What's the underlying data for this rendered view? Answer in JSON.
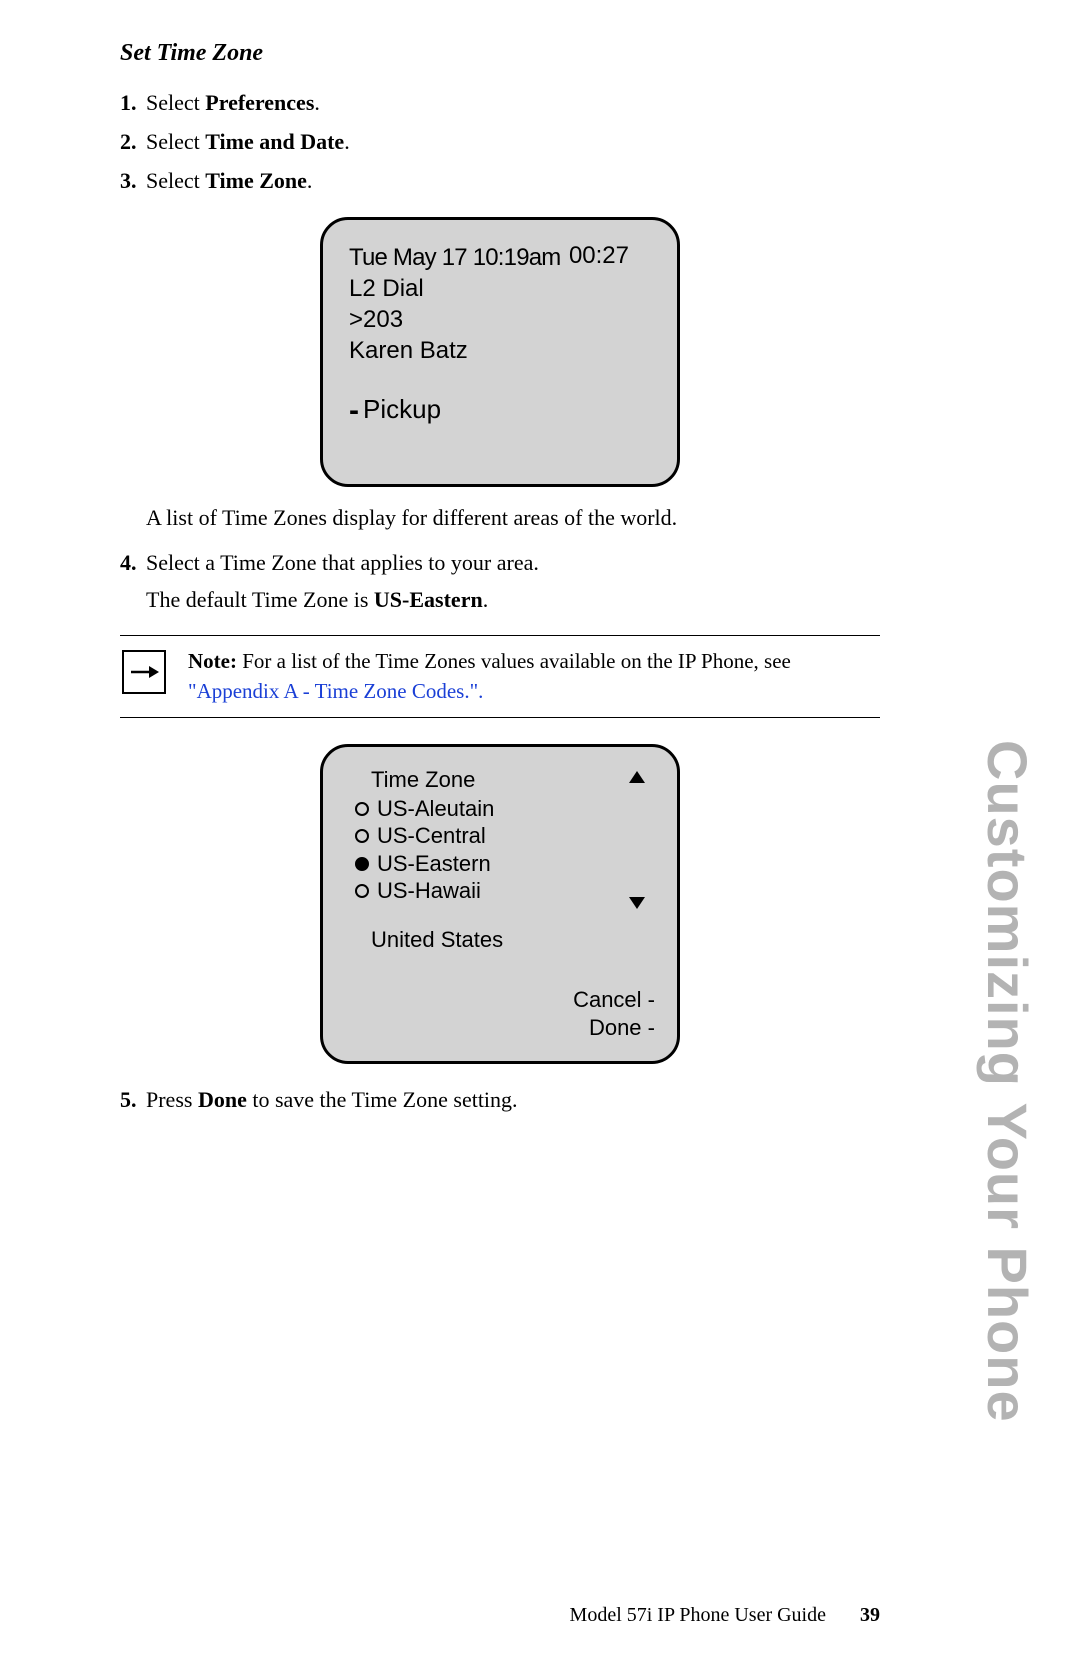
{
  "section_title": "Set Time Zone",
  "steps": {
    "s1_num": "1.",
    "s1_a": "Select ",
    "s1_b": "Preferences",
    "s1_c": ".",
    "s2_num": "2.",
    "s2_a": "Select ",
    "s2_b": "Time and Date",
    "s2_c": ".",
    "s3_num": "3.",
    "s3_a": "Select ",
    "s3_b": "Time Zone",
    "s3_c": ".",
    "s3_followup": "A list of Time Zones display for different areas of the world.",
    "s4_num": "4.",
    "s4_text": "Select a Time Zone that applies to your area.",
    "s4_sub_a": "The default Time Zone is ",
    "s4_sub_b": "US-Eastern",
    "s4_sub_c": ".",
    "s5_num": "5.",
    "s5_a": "Press ",
    "s5_b": "Done",
    "s5_c": " to save the Time Zone setting."
  },
  "screen1": {
    "datetime": "Tue May 17 10:19am",
    "duration": "00:27",
    "line2": "L2 Dial",
    "line3": ">203",
    "line4": "Karen Batz",
    "pickup": "Pickup"
  },
  "note": {
    "label": "Note:",
    "text": " For a list of the Time Zones values available on the IP Phone, see ",
    "link": "\"Appendix A - Time Zone Codes.\".",
    "icon": "arrow-right-icon"
  },
  "screen2": {
    "title": "Time Zone",
    "options": [
      {
        "label": "US-Aleutain",
        "selected": false
      },
      {
        "label": "US-Central",
        "selected": false
      },
      {
        "label": "US-Eastern",
        "selected": true
      },
      {
        "label": "US-Hawaii",
        "selected": false
      }
    ],
    "opt0": "US-Aleutain",
    "opt1": "US-Central",
    "opt2": "US-Eastern",
    "opt3": "US-Hawaii",
    "region": "United States",
    "cancel": "Cancel -",
    "done": "Done -",
    "up_icon": "triangle-up-icon",
    "down_icon": "triangle-down-icon"
  },
  "side_title": "Customizing Your Phone",
  "footer": {
    "text": "Model 57i IP Phone User Guide",
    "page": "39"
  }
}
